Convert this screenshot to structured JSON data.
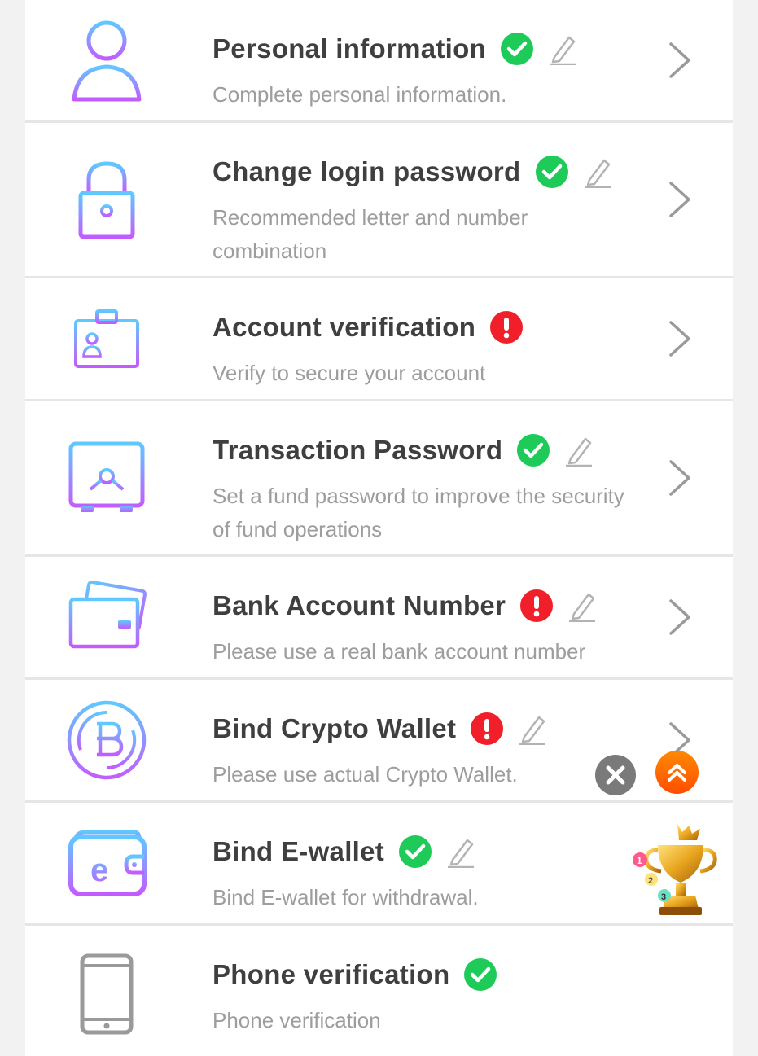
{
  "items": [
    {
      "id": "personal",
      "title": "Personal information",
      "subtitle": "Complete personal information.",
      "icon": "user-icon",
      "status": "verified",
      "editable": true,
      "chevron": true
    },
    {
      "id": "login",
      "title": "Change login password",
      "subtitle": "Recommended letter and number combination",
      "icon": "lock-icon",
      "status": "verified",
      "editable": true,
      "chevron": true
    },
    {
      "id": "account",
      "title": "Account verification",
      "subtitle": "Verify to secure your account",
      "icon": "id-card-icon",
      "status": "warning",
      "editable": false,
      "chevron": true
    },
    {
      "id": "txpass",
      "title": "Transaction Password",
      "subtitle": "Set a fund password to improve the security of fund operations",
      "icon": "safe-icon",
      "status": "verified",
      "editable": true,
      "chevron": true
    },
    {
      "id": "bank",
      "title": "Bank Account Number",
      "subtitle": "Please use a real bank account number",
      "icon": "bank-card-icon",
      "status": "warning",
      "editable": true,
      "chevron": true
    },
    {
      "id": "crypto",
      "title": "Bind Crypto Wallet",
      "subtitle": "Please use actual Crypto Wallet.",
      "icon": "bitcoin-icon",
      "status": "warning",
      "editable": true,
      "chevron": true
    },
    {
      "id": "ewallet",
      "title": "Bind E-wallet",
      "subtitle": "Bind E-wallet for withdrawal.",
      "icon": "e-wallet-icon",
      "status": "verified",
      "editable": true,
      "chevron": false
    },
    {
      "id": "phone",
      "title": "Phone verification",
      "subtitle": "Phone verification",
      "icon": "phone-icon",
      "status": "verified",
      "editable": false,
      "chevron": false
    }
  ],
  "colors": {
    "verified": "#1ecb59",
    "warning": "#f01f2a",
    "gradient_top": "#5fc3ff",
    "gradient_bottom": "#c45cff",
    "float_up": "#ff6a00",
    "float_close": "#7a7a7a"
  }
}
